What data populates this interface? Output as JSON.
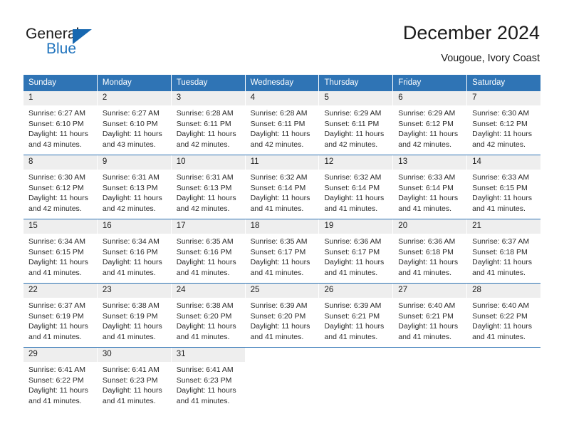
{
  "brand": {
    "name_part1": "General",
    "name_part2": "Blue",
    "triangle_color": "#1667b0",
    "blue_text_color": "#1f73bd"
  },
  "header": {
    "title": "December 2024",
    "subtitle": "Vougoue, Ivory Coast"
  },
  "theme": {
    "header_blue": "#2f74b5",
    "day_number_band": "#eeeeee",
    "text": "#202020"
  },
  "weekday_headers": [
    "Sunday",
    "Monday",
    "Tuesday",
    "Wednesday",
    "Thursday",
    "Friday",
    "Saturday"
  ],
  "weeks": [
    [
      {
        "day": "1",
        "sunrise": "Sunrise: 6:27 AM",
        "sunset": "Sunset: 6:10 PM",
        "daylight1": "Daylight: 11 hours",
        "daylight2": "and 43 minutes."
      },
      {
        "day": "2",
        "sunrise": "Sunrise: 6:27 AM",
        "sunset": "Sunset: 6:10 PM",
        "daylight1": "Daylight: 11 hours",
        "daylight2": "and 43 minutes."
      },
      {
        "day": "3",
        "sunrise": "Sunrise: 6:28 AM",
        "sunset": "Sunset: 6:11 PM",
        "daylight1": "Daylight: 11 hours",
        "daylight2": "and 42 minutes."
      },
      {
        "day": "4",
        "sunrise": "Sunrise: 6:28 AM",
        "sunset": "Sunset: 6:11 PM",
        "daylight1": "Daylight: 11 hours",
        "daylight2": "and 42 minutes."
      },
      {
        "day": "5",
        "sunrise": "Sunrise: 6:29 AM",
        "sunset": "Sunset: 6:11 PM",
        "daylight1": "Daylight: 11 hours",
        "daylight2": "and 42 minutes."
      },
      {
        "day": "6",
        "sunrise": "Sunrise: 6:29 AM",
        "sunset": "Sunset: 6:12 PM",
        "daylight1": "Daylight: 11 hours",
        "daylight2": "and 42 minutes."
      },
      {
        "day": "7",
        "sunrise": "Sunrise: 6:30 AM",
        "sunset": "Sunset: 6:12 PM",
        "daylight1": "Daylight: 11 hours",
        "daylight2": "and 42 minutes."
      }
    ],
    [
      {
        "day": "8",
        "sunrise": "Sunrise: 6:30 AM",
        "sunset": "Sunset: 6:12 PM",
        "daylight1": "Daylight: 11 hours",
        "daylight2": "and 42 minutes."
      },
      {
        "day": "9",
        "sunrise": "Sunrise: 6:31 AM",
        "sunset": "Sunset: 6:13 PM",
        "daylight1": "Daylight: 11 hours",
        "daylight2": "and 42 minutes."
      },
      {
        "day": "10",
        "sunrise": "Sunrise: 6:31 AM",
        "sunset": "Sunset: 6:13 PM",
        "daylight1": "Daylight: 11 hours",
        "daylight2": "and 42 minutes."
      },
      {
        "day": "11",
        "sunrise": "Sunrise: 6:32 AM",
        "sunset": "Sunset: 6:14 PM",
        "daylight1": "Daylight: 11 hours",
        "daylight2": "and 41 minutes."
      },
      {
        "day": "12",
        "sunrise": "Sunrise: 6:32 AM",
        "sunset": "Sunset: 6:14 PM",
        "daylight1": "Daylight: 11 hours",
        "daylight2": "and 41 minutes."
      },
      {
        "day": "13",
        "sunrise": "Sunrise: 6:33 AM",
        "sunset": "Sunset: 6:14 PM",
        "daylight1": "Daylight: 11 hours",
        "daylight2": "and 41 minutes."
      },
      {
        "day": "14",
        "sunrise": "Sunrise: 6:33 AM",
        "sunset": "Sunset: 6:15 PM",
        "daylight1": "Daylight: 11 hours",
        "daylight2": "and 41 minutes."
      }
    ],
    [
      {
        "day": "15",
        "sunrise": "Sunrise: 6:34 AM",
        "sunset": "Sunset: 6:15 PM",
        "daylight1": "Daylight: 11 hours",
        "daylight2": "and 41 minutes."
      },
      {
        "day": "16",
        "sunrise": "Sunrise: 6:34 AM",
        "sunset": "Sunset: 6:16 PM",
        "daylight1": "Daylight: 11 hours",
        "daylight2": "and 41 minutes."
      },
      {
        "day": "17",
        "sunrise": "Sunrise: 6:35 AM",
        "sunset": "Sunset: 6:16 PM",
        "daylight1": "Daylight: 11 hours",
        "daylight2": "and 41 minutes."
      },
      {
        "day": "18",
        "sunrise": "Sunrise: 6:35 AM",
        "sunset": "Sunset: 6:17 PM",
        "daylight1": "Daylight: 11 hours",
        "daylight2": "and 41 minutes."
      },
      {
        "day": "19",
        "sunrise": "Sunrise: 6:36 AM",
        "sunset": "Sunset: 6:17 PM",
        "daylight1": "Daylight: 11 hours",
        "daylight2": "and 41 minutes."
      },
      {
        "day": "20",
        "sunrise": "Sunrise: 6:36 AM",
        "sunset": "Sunset: 6:18 PM",
        "daylight1": "Daylight: 11 hours",
        "daylight2": "and 41 minutes."
      },
      {
        "day": "21",
        "sunrise": "Sunrise: 6:37 AM",
        "sunset": "Sunset: 6:18 PM",
        "daylight1": "Daylight: 11 hours",
        "daylight2": "and 41 minutes."
      }
    ],
    [
      {
        "day": "22",
        "sunrise": "Sunrise: 6:37 AM",
        "sunset": "Sunset: 6:19 PM",
        "daylight1": "Daylight: 11 hours",
        "daylight2": "and 41 minutes."
      },
      {
        "day": "23",
        "sunrise": "Sunrise: 6:38 AM",
        "sunset": "Sunset: 6:19 PM",
        "daylight1": "Daylight: 11 hours",
        "daylight2": "and 41 minutes."
      },
      {
        "day": "24",
        "sunrise": "Sunrise: 6:38 AM",
        "sunset": "Sunset: 6:20 PM",
        "daylight1": "Daylight: 11 hours",
        "daylight2": "and 41 minutes."
      },
      {
        "day": "25",
        "sunrise": "Sunrise: 6:39 AM",
        "sunset": "Sunset: 6:20 PM",
        "daylight1": "Daylight: 11 hours",
        "daylight2": "and 41 minutes."
      },
      {
        "day": "26",
        "sunrise": "Sunrise: 6:39 AM",
        "sunset": "Sunset: 6:21 PM",
        "daylight1": "Daylight: 11 hours",
        "daylight2": "and 41 minutes."
      },
      {
        "day": "27",
        "sunrise": "Sunrise: 6:40 AM",
        "sunset": "Sunset: 6:21 PM",
        "daylight1": "Daylight: 11 hours",
        "daylight2": "and 41 minutes."
      },
      {
        "day": "28",
        "sunrise": "Sunrise: 6:40 AM",
        "sunset": "Sunset: 6:22 PM",
        "daylight1": "Daylight: 11 hours",
        "daylight2": "and 41 minutes."
      }
    ],
    [
      {
        "day": "29",
        "sunrise": "Sunrise: 6:41 AM",
        "sunset": "Sunset: 6:22 PM",
        "daylight1": "Daylight: 11 hours",
        "daylight2": "and 41 minutes."
      },
      {
        "day": "30",
        "sunrise": "Sunrise: 6:41 AM",
        "sunset": "Sunset: 6:23 PM",
        "daylight1": "Daylight: 11 hours",
        "daylight2": "and 41 minutes."
      },
      {
        "day": "31",
        "sunrise": "Sunrise: 6:41 AM",
        "sunset": "Sunset: 6:23 PM",
        "daylight1": "Daylight: 11 hours",
        "daylight2": "and 41 minutes."
      },
      {
        "day": "",
        "sunrise": "",
        "sunset": "",
        "daylight1": "",
        "daylight2": ""
      },
      {
        "day": "",
        "sunrise": "",
        "sunset": "",
        "daylight1": "",
        "daylight2": ""
      },
      {
        "day": "",
        "sunrise": "",
        "sunset": "",
        "daylight1": "",
        "daylight2": ""
      },
      {
        "day": "",
        "sunrise": "",
        "sunset": "",
        "daylight1": "",
        "daylight2": ""
      }
    ]
  ]
}
